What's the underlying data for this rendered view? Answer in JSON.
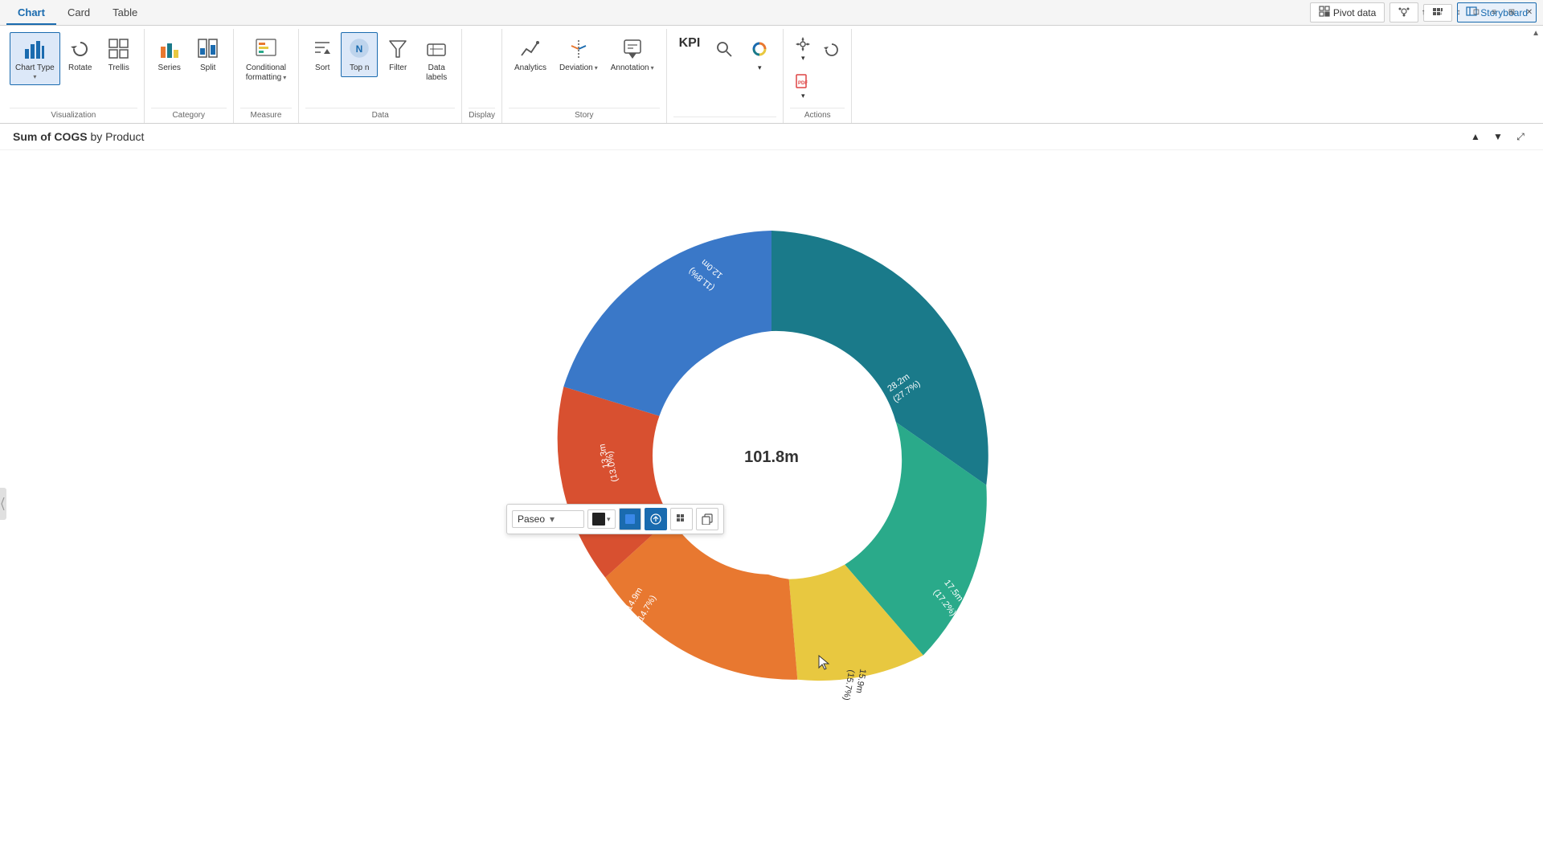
{
  "tabs": [
    {
      "label": "Chart",
      "active": true
    },
    {
      "label": "Card",
      "active": false
    },
    {
      "label": "Table",
      "active": false
    }
  ],
  "topbar": {
    "pivot_data": "Pivot  data",
    "storyboard": "Storyboard"
  },
  "ribbon": {
    "visualization_group": {
      "label": "Visualization",
      "buttons": [
        {
          "id": "chart-type",
          "label": "Chart Type",
          "active": true,
          "has_chevron": true
        },
        {
          "id": "rotate",
          "label": "Rotate",
          "active": false
        },
        {
          "id": "trellis",
          "label": "Trellis",
          "active": false
        }
      ]
    },
    "category_group": {
      "label": "Category",
      "buttons": [
        {
          "id": "series",
          "label": "Series",
          "active": false
        },
        {
          "id": "split",
          "label": "Split",
          "active": false
        }
      ]
    },
    "measure_group": {
      "label": "Measure",
      "buttons": [
        {
          "id": "conditional-formatting",
          "label": "Conditional\nformatting",
          "active": false,
          "has_chevron": true
        }
      ]
    },
    "data_group": {
      "label": "Data",
      "buttons": [
        {
          "id": "sort",
          "label": "Sort",
          "active": false
        },
        {
          "id": "top-n",
          "label": "Top n",
          "active": true
        },
        {
          "id": "filter",
          "label": "Filter",
          "active": false
        },
        {
          "id": "data-labels",
          "label": "Data\nlabels",
          "active": false
        }
      ]
    },
    "display_group": {
      "label": "Display",
      "buttons": []
    },
    "story_group": {
      "label": "Story",
      "buttons": [
        {
          "id": "analytics",
          "label": "Analytics",
          "active": false
        },
        {
          "id": "deviation",
          "label": "Deviation",
          "active": false,
          "has_chevron": true
        },
        {
          "id": "annotation",
          "label": "Annotation",
          "active": false,
          "has_chevron": true
        }
      ]
    },
    "kpi": {
      "label": "KPI"
    },
    "actions_group": {
      "label": "Actions",
      "buttons": []
    }
  },
  "chart": {
    "title": "Sum of COGS",
    "subtitle": "by Product",
    "center_value": "101.8m",
    "segments": [
      {
        "label": "28.2m\n(27.7%)",
        "color": "#1a7a8a",
        "percentage": 27.7,
        "start_angle": -90,
        "sweep": 99.7
      },
      {
        "label": "17.5m\n(17.2%)",
        "color": "#2aaa8a",
        "percentage": 17.2,
        "start_angle": 9.7,
        "sweep": 61.9
      },
      {
        "label": "15.9m\n(15.7%)",
        "color": "#e8c840",
        "percentage": 15.7,
        "start_angle": 71.6,
        "sweep": 56.5
      },
      {
        "label": "14.9m\n(14.7%)",
        "color": "#e87830",
        "percentage": 14.7,
        "start_angle": 128.1,
        "sweep": 52.9
      },
      {
        "label": "13.3m\n(13.0%)",
        "color": "#d85030",
        "percentage": 13.0,
        "start_angle": 181.0,
        "sweep": 46.8
      },
      {
        "label": "12.0m\n(11.8%)",
        "color": "#3a78c8",
        "percentage": 11.8,
        "start_angle": 227.8,
        "sweep": 42.5
      }
    ]
  },
  "popup": {
    "font_select": "Paseo",
    "font_dropdown": true,
    "color_label": "black"
  },
  "title_buttons": {
    "up": "▲",
    "down": "▼",
    "fit": "⤢"
  }
}
